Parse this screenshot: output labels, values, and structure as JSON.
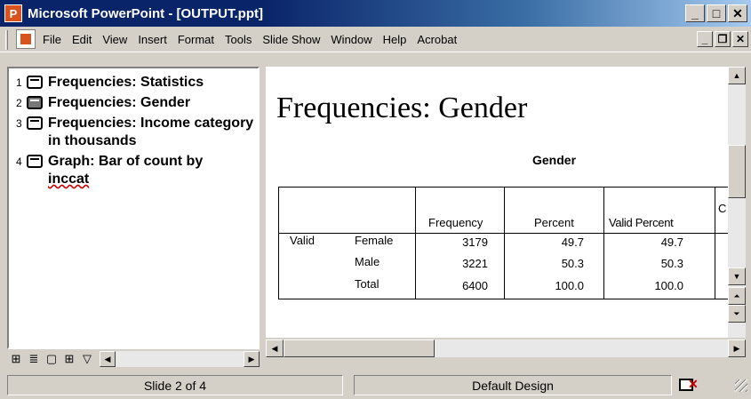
{
  "window": {
    "title": "Microsoft PowerPoint - [OUTPUT.ppt]",
    "app_icon": "powerpoint-icon",
    "controls": {
      "minimize": "_",
      "maximize": "□",
      "close": "✕"
    }
  },
  "menu": {
    "items": [
      "File",
      "Edit",
      "View",
      "Insert",
      "Format",
      "Tools",
      "Slide Show",
      "Window",
      "Help",
      "Acrobat"
    ],
    "doc_controls": {
      "minimize": "_",
      "restore": "❐",
      "close": "✕"
    }
  },
  "outline": {
    "items": [
      {
        "num": "1",
        "title": "Frequencies: Statistics",
        "selected": false
      },
      {
        "num": "2",
        "title": "Frequencies: Gender",
        "selected": true
      },
      {
        "num": "3",
        "title": "Frequencies: Income category in thousands",
        "selected": false
      },
      {
        "num": "4",
        "title": "Graph: Bar of count by",
        "title2": "inccat",
        "selected": false
      }
    ]
  },
  "slide": {
    "title": "Frequencies: Gender",
    "table_title": "Gender",
    "columns": [
      "Frequency",
      "Percent",
      "Valid Percent",
      "C"
    ],
    "group_label": "Valid",
    "rows": [
      {
        "label": "Female",
        "frequency": "3179",
        "percent": "49.7",
        "valid_percent": "49.7"
      },
      {
        "label": "Male",
        "frequency": "3221",
        "percent": "50.3",
        "valid_percent": "50.3"
      },
      {
        "label": "Total",
        "frequency": "6400",
        "percent": "100.0",
        "valid_percent": "100.0"
      }
    ]
  },
  "status": {
    "slide": "Slide 2 of 4",
    "design": "Default Design"
  }
}
